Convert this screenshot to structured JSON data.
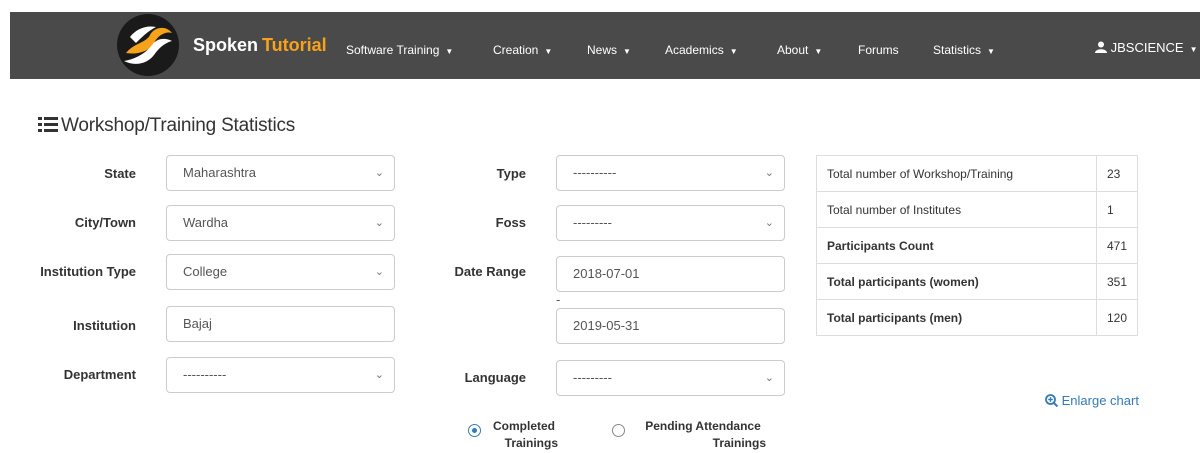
{
  "navbar": {
    "brand_first": "Spoken",
    "brand_second": "Tutorial",
    "items": [
      {
        "label": "Software Training",
        "caret": "▼"
      },
      {
        "label": "Creation",
        "caret": "▼"
      },
      {
        "label": "News",
        "caret": "▼"
      },
      {
        "label": "Academics",
        "caret": "▼"
      },
      {
        "label": "About",
        "caret": "▼"
      },
      {
        "label": "Forums",
        "caret": ""
      },
      {
        "label": "Statistics",
        "caret": "▼"
      }
    ],
    "user": "JBSCIENCE",
    "user_caret": "▼",
    "colors": {
      "bar": "#4a4a4a",
      "accent": "#f7a21b"
    }
  },
  "page_title": "Workshop/Training Statistics",
  "filters": {
    "state": {
      "label": "State",
      "value": "Maharashtra"
    },
    "city": {
      "label": "City/Town",
      "value": "Wardha"
    },
    "institution_type": {
      "label": "Institution Type",
      "value": "College"
    },
    "institution": {
      "label": "Institution",
      "value": "Bajaj"
    },
    "department": {
      "label": "Department",
      "value": "----------"
    },
    "type": {
      "label": "Type",
      "value": "----------"
    },
    "foss": {
      "label": "Foss",
      "value": "---------"
    },
    "date_range": {
      "label": "Date Range",
      "from": "2018-07-01",
      "separator": "-",
      "to": "2019-05-31"
    },
    "language": {
      "label": "Language",
      "value": "---------"
    }
  },
  "radio": {
    "completed": {
      "line1": "Completed",
      "line2": "Trainings",
      "checked": true
    },
    "pending": {
      "line1": "Pending Attendance",
      "line2": "Trainings",
      "checked": false
    }
  },
  "stats": [
    {
      "label": "Total number of Workshop/Training",
      "value": "23"
    },
    {
      "label": "Total number of Institutes",
      "value": "1"
    },
    {
      "label": "Participants Count",
      "value": "471"
    },
    {
      "label": "Total participants (women)",
      "value": "351"
    },
    {
      "label": "Total participants (men)",
      "value": "120"
    }
  ],
  "enlarge_chart": "Enlarge chart",
  "dropdown_caret": "⌄",
  "link_color": "#337ab7"
}
